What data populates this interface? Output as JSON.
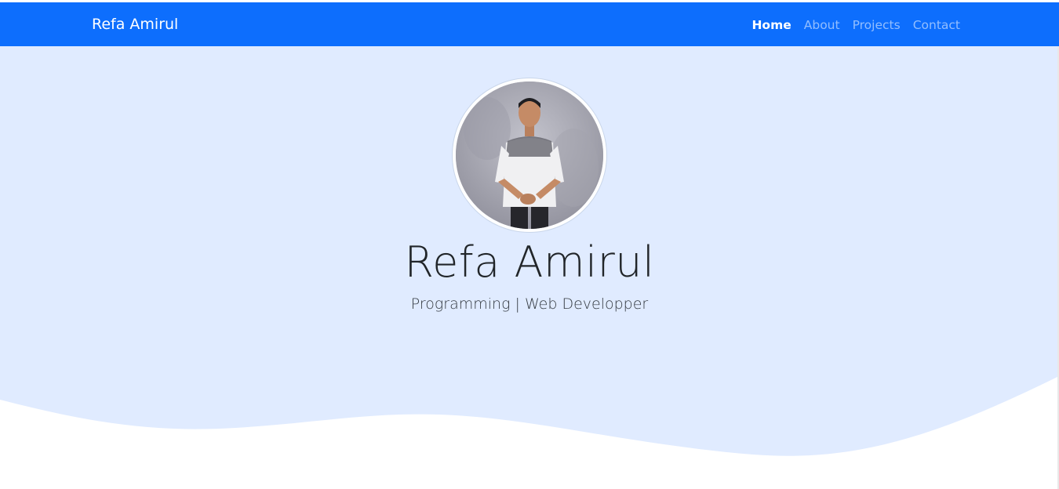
{
  "navbar": {
    "brand": "Refa Amirul",
    "items": [
      {
        "label": "Home",
        "active": true
      },
      {
        "label": "About",
        "active": false
      },
      {
        "label": "Projects",
        "active": false
      },
      {
        "label": "Contact",
        "active": false
      }
    ]
  },
  "hero": {
    "title": "Refa Amirul",
    "subtitle": "Programming | Web Developper"
  },
  "colors": {
    "navbar_bg": "#0d6efd",
    "hero_bg": "#e0ebff",
    "wave": "#ffffff"
  }
}
